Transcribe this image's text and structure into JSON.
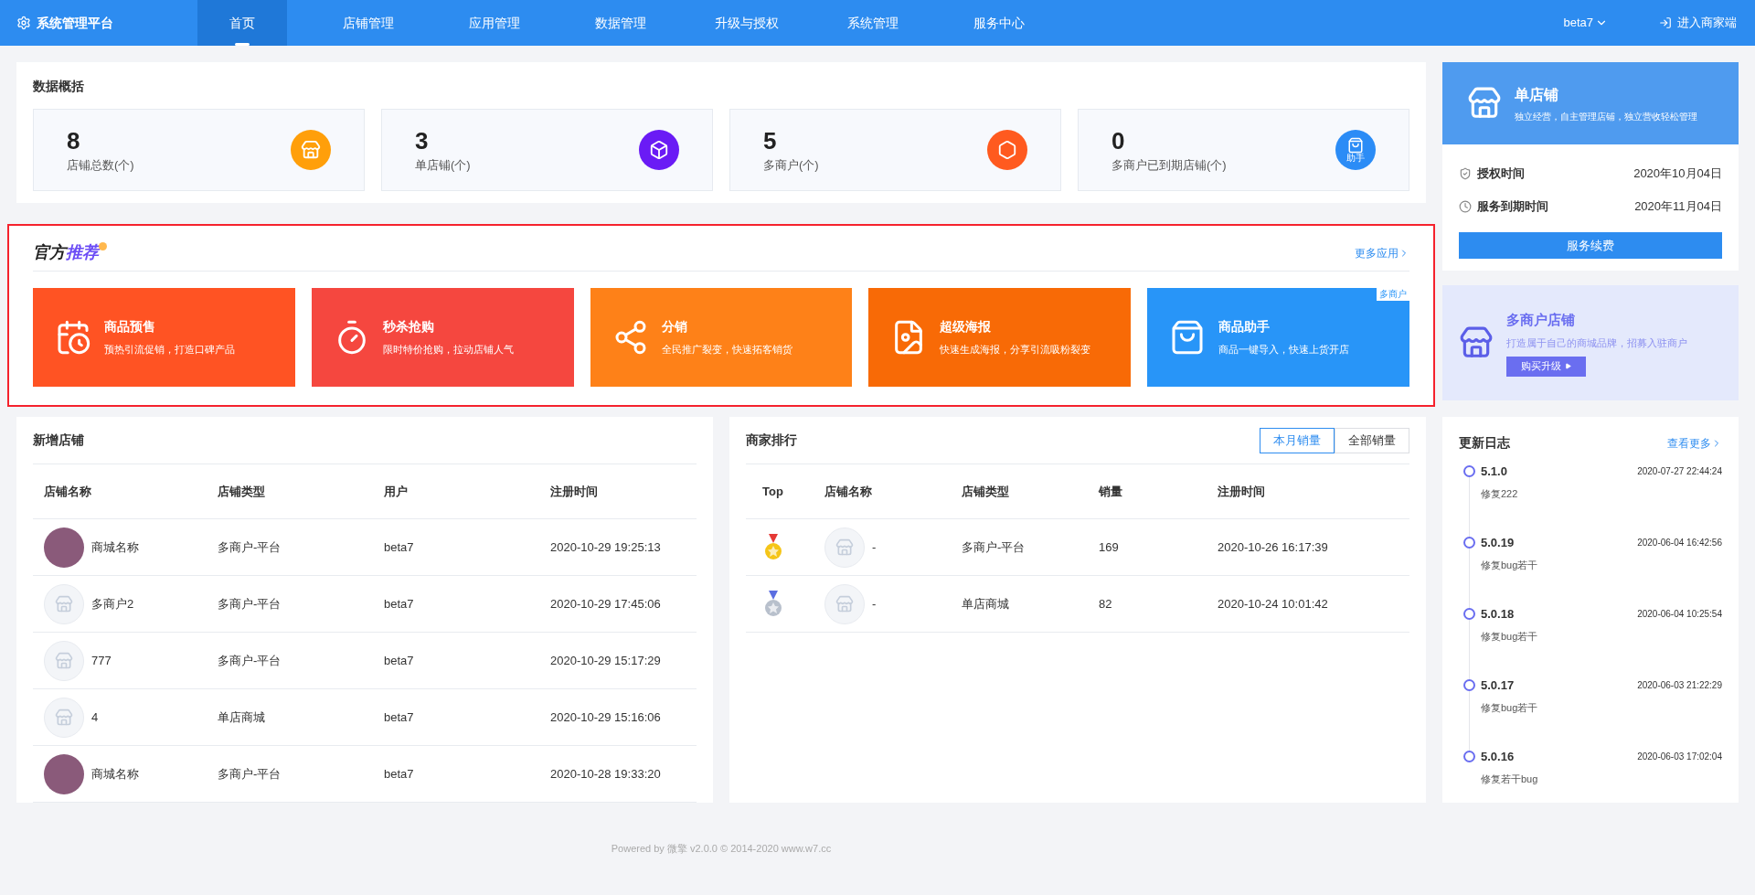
{
  "header": {
    "brand": "系统管理平台",
    "nav": [
      {
        "label": "首页",
        "selected": true
      },
      {
        "label": "店铺管理",
        "selected": false
      },
      {
        "label": "应用管理",
        "selected": false
      },
      {
        "label": "数据管理",
        "selected": false
      },
      {
        "label": "升级与授权",
        "selected": false
      },
      {
        "label": "系统管理",
        "selected": false
      },
      {
        "label": "服务中心",
        "selected": false
      }
    ],
    "user": "beta7",
    "enter_shop": "进入商家端"
  },
  "overview": {
    "title": "数据概括",
    "stats": [
      {
        "value": "8",
        "label": "店铺总数(个)",
        "color": "#ff9f0a",
        "kind": "store"
      },
      {
        "value": "3",
        "label": "单店铺(个)",
        "color": "#6a1bf5",
        "kind": "cube"
      },
      {
        "value": "5",
        "label": "多商户(个)",
        "color": "#ff5a1f",
        "kind": "hexagons"
      },
      {
        "value": "0",
        "label": "多商户已到期店铺(个)",
        "color": "#2b8cf6",
        "kind": "bag",
        "icon_text": "助手"
      }
    ]
  },
  "recommend": {
    "title_a": "官方",
    "title_b": "推荐",
    "more": "更多应用",
    "apps": [
      {
        "name": "商品预售",
        "desc": "预热引流促销，打造口碑产品",
        "color": "#ff5323",
        "kind": "presale"
      },
      {
        "name": "秒杀抢购",
        "desc": "限时特价抢购，拉动店铺人气",
        "color": "#f5473f",
        "kind": "timer"
      },
      {
        "name": "分销",
        "desc": "全民推广裂变，快速拓客销货",
        "color": "#fe8118",
        "kind": "share"
      },
      {
        "name": "超级海报",
        "desc": "快速生成海报，分享引流吸粉裂变",
        "color": "#f86a06",
        "kind": "poster"
      },
      {
        "name": "商品助手",
        "desc": "商品一键导入，快速上货开店",
        "color": "#2895f8",
        "kind": "bag",
        "badge": "多商户"
      }
    ]
  },
  "new_stores": {
    "title": "新增店铺",
    "columns": [
      "店铺名称",
      "店铺类型",
      "用户",
      "注册时间"
    ],
    "rows": [
      {
        "kind": "photo",
        "name": "商城名称",
        "type": "多商户-平台",
        "user": "beta7",
        "time": "2020-10-29 19:25:13"
      },
      {
        "kind": "placeholder",
        "name": "多商户2",
        "type": "多商户-平台",
        "user": "beta7",
        "time": "2020-10-29 17:45:06"
      },
      {
        "kind": "placeholder",
        "name": "777",
        "type": "多商户-平台",
        "user": "beta7",
        "time": "2020-10-29 15:17:29"
      },
      {
        "kind": "placeholder",
        "name": "4",
        "type": "单店商城",
        "user": "beta7",
        "time": "2020-10-29 15:16:06"
      },
      {
        "kind": "photo",
        "name": "商城名称",
        "type": "多商户-平台",
        "user": "beta7",
        "time": "2020-10-28 19:33:20"
      }
    ]
  },
  "ranking": {
    "title": "商家排行",
    "tabs": [
      {
        "label": "本月销量",
        "selected": true
      },
      {
        "label": "全部销量",
        "selected": false
      }
    ],
    "columns": [
      "Top",
      "店铺名称",
      "店铺类型",
      "销量",
      "注册时间"
    ],
    "rows": [
      {
        "kind": "gold",
        "name": "-",
        "type": "多商户-平台",
        "sales": "169",
        "time": "2020-10-26 16:17:39"
      },
      {
        "kind": "silver",
        "name": "-",
        "type": "单店商城",
        "sales": "82",
        "time": "2020-10-24 10:01:42"
      }
    ]
  },
  "license": {
    "title": "单店铺",
    "desc": "独立经营，自主管理店铺，独立营收轻松管理",
    "items": [
      {
        "label": "授权时间",
        "value": "2020年10月04日",
        "kind": "shield"
      },
      {
        "label": "服务到期时间",
        "value": "2020年11月04日",
        "kind": "clock"
      }
    ],
    "button": "服务续费"
  },
  "multi_shop": {
    "title": "多商户店铺",
    "desc": "打造属于自己的商城品牌，招募入驻商户",
    "button": "购买升级"
  },
  "changelog": {
    "title": "更新日志",
    "more": "查看更多",
    "entries": [
      {
        "version": "5.1.0",
        "time": "2020-07-27 22:44:24",
        "note": "修复222"
      },
      {
        "version": "5.0.19",
        "time": "2020-06-04 16:42:56",
        "note": "修复bug若干"
      },
      {
        "version": "5.0.18",
        "time": "2020-06-04 10:25:54",
        "note": "修复bug若干"
      },
      {
        "version": "5.0.17",
        "time": "2020-06-03 21:22:29",
        "note": "修复bug若干"
      },
      {
        "version": "5.0.16",
        "time": "2020-06-03 17:02:04",
        "note": "修复若干bug"
      }
    ]
  },
  "footer": "Powered by 微擎 v2.0.0 © 2014-2020 www.w7.cc"
}
